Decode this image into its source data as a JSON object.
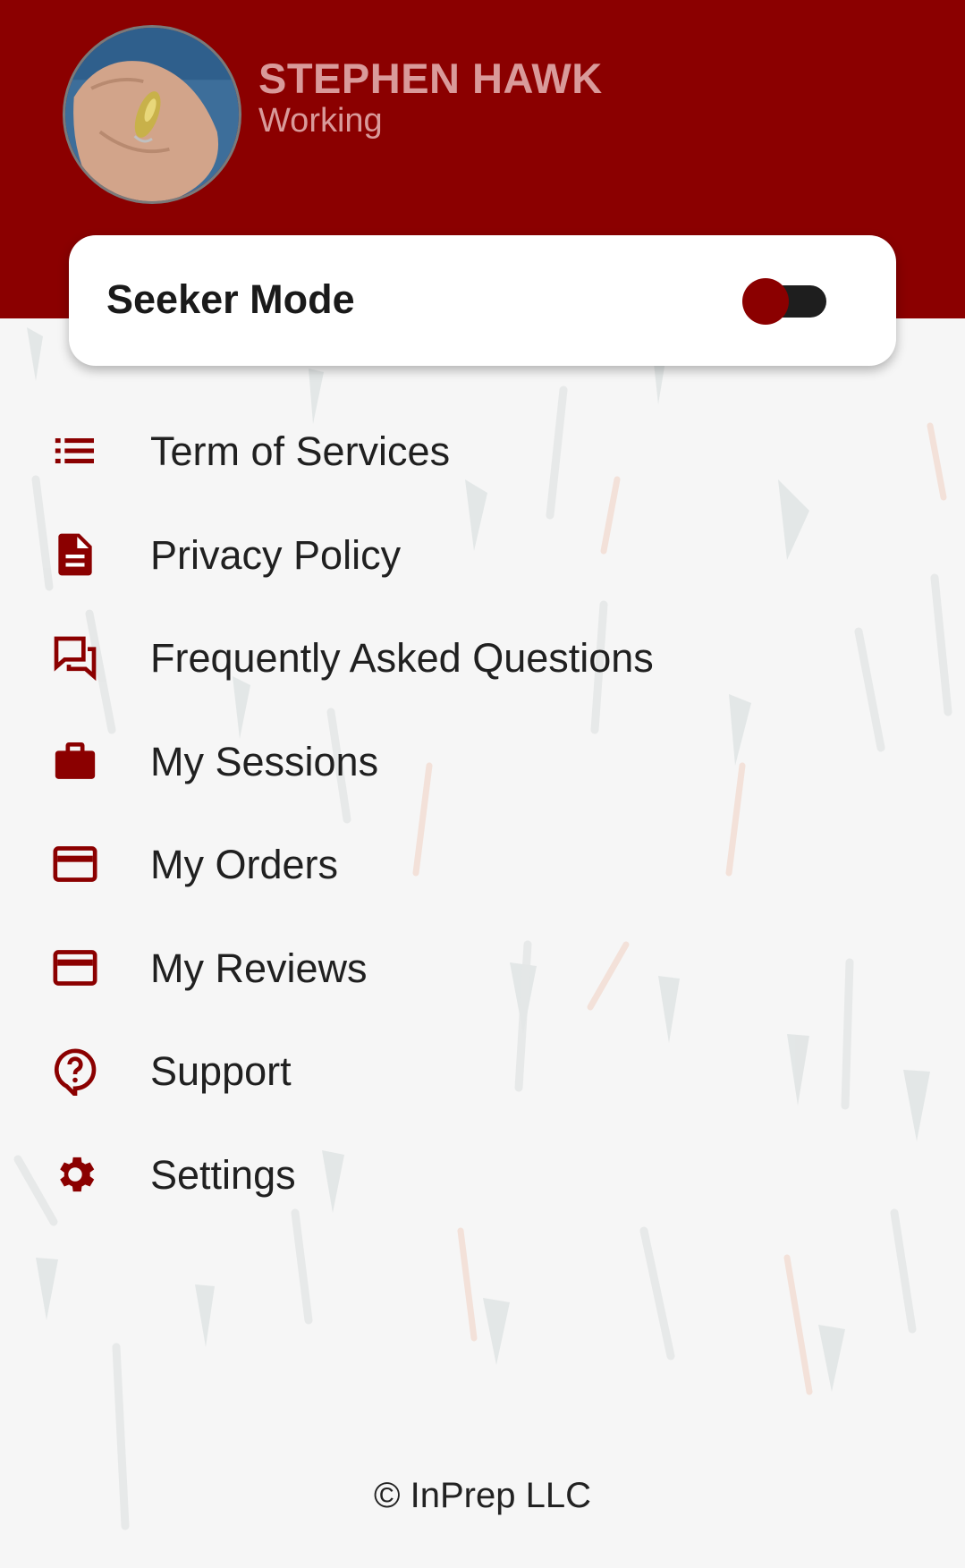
{
  "profile": {
    "name": "STEPHEN HAWK",
    "status": "Working",
    "avatar_icon": "profile-photo"
  },
  "mode": {
    "label": "Seeker Mode",
    "toggle_on": false
  },
  "menu": {
    "items": [
      {
        "label": "Term of Services",
        "icon": "list-icon"
      },
      {
        "label": "Privacy Policy",
        "icon": "document-icon"
      },
      {
        "label": "Frequently Asked Questions",
        "icon": "forum-icon"
      },
      {
        "label": "My Sessions",
        "icon": "briefcase-icon"
      },
      {
        "label": "My Orders",
        "icon": "credit-card-icon"
      },
      {
        "label": "My Reviews",
        "icon": "credit-card-icon"
      },
      {
        "label": "Support",
        "icon": "help-icon"
      },
      {
        "label": "Settings",
        "icon": "gear-icon"
      }
    ]
  },
  "footer": {
    "copyright": "© InPrep LLC"
  },
  "colors": {
    "brand": "#8b0000",
    "profile_text": "#d99a9a",
    "background": "#f6f6f6"
  }
}
